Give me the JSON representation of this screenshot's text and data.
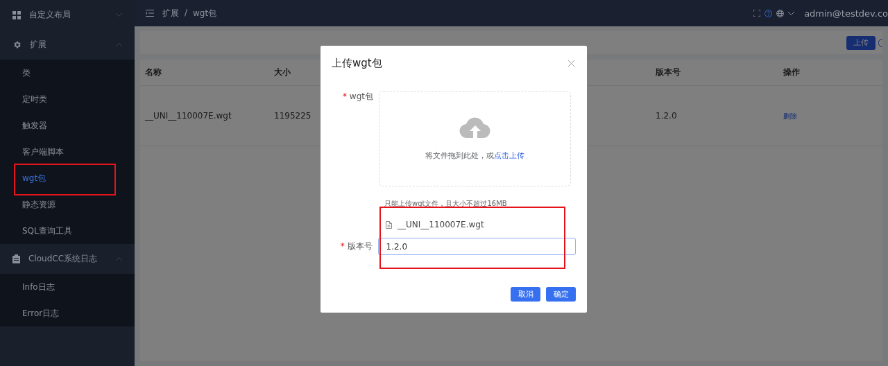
{
  "sidebar": {
    "groups": [
      {
        "label": "自定义布局",
        "expanded": false
      },
      {
        "label": "扩展",
        "expanded": true,
        "items": [
          {
            "label": "类",
            "selected": false,
            "highlighted": false
          },
          {
            "label": "定时类",
            "selected": false,
            "highlighted": false
          },
          {
            "label": "触发器",
            "selected": false,
            "highlighted": false
          },
          {
            "label": "客户端脚本",
            "selected": false,
            "highlighted": false
          },
          {
            "label": "wgt包",
            "selected": true,
            "highlighted": true
          },
          {
            "label": "静态资源",
            "selected": false,
            "highlighted": false
          },
          {
            "label": "SQL查询工具",
            "selected": false,
            "highlighted": false
          }
        ]
      },
      {
        "label": "CloudCC系统日志",
        "expanded": true,
        "items": [
          {
            "label": "Info日志",
            "selected": false,
            "highlighted": false
          },
          {
            "label": "Error日志",
            "selected": false,
            "highlighted": false
          }
        ]
      }
    ]
  },
  "header": {
    "breadcrumb": [
      "扩展",
      "wgt包"
    ],
    "separator": "/",
    "user": "admin@testdev.co"
  },
  "toolbar": {
    "upload_button": "上传"
  },
  "table": {
    "columns": [
      "名称",
      "大小",
      "",
      "",
      "版本号",
      "操作"
    ],
    "rows": [
      {
        "cells": [
          "__UNI__110007E.wgt",
          "1195225",
          "",
          "",
          "1.2.0"
        ],
        "action": "删除"
      }
    ]
  },
  "dialog": {
    "title": "上传wgt包",
    "package_label": "wgt包",
    "required": true,
    "required_mark": "*",
    "dropzone": {
      "text": "将文件拖到此处，或",
      "link": "点击上传"
    },
    "tip": "只能上传wgt文件，且大小不超过16MB",
    "file": "__UNI__110007E.wgt",
    "highlighted": true,
    "version_label": "版本号",
    "version_value": "1.2.0",
    "buttons": [
      "取消",
      "确定"
    ]
  }
}
